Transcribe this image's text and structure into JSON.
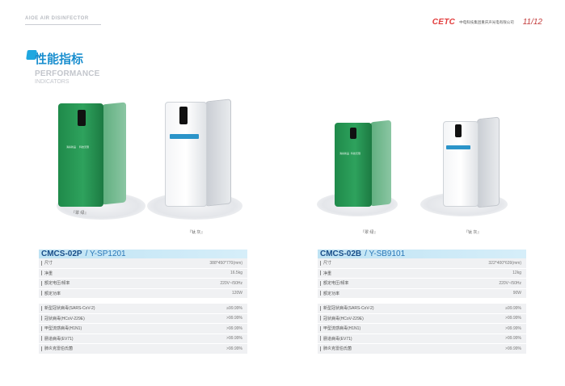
{
  "header": {
    "left_title": "AIOE AIR DISINFECTOR",
    "logo_text": "CETC",
    "company": "中电科技集团重庆声光电有限公司",
    "page": "11/12"
  },
  "title": {
    "cn": "性能指标",
    "en1": "PERFORMANCE",
    "en2": "INDICATORS"
  },
  "product_text": {
    "panel_line1": "消杀新品",
    "panel_line2": "科技无限"
  },
  "products": {
    "left": {
      "green_label": "『翠 绿』",
      "white_label": "『钛 灰』"
    },
    "right": {
      "green_label": "『翠 绿』",
      "white_label": "『钛 灰』"
    }
  },
  "specs": {
    "left": {
      "model": "CMCS-02P",
      "alt": "/ Y-SP1201",
      "rows1": [
        {
          "label": "尺寸",
          "value": "388*450*770(mm)"
        },
        {
          "label": "净重",
          "value": "16.5kg"
        },
        {
          "label": "额定电压/频率",
          "value": "220V~/50Hz"
        },
        {
          "label": "额定功率",
          "value": "120W"
        }
      ],
      "rows2": [
        {
          "label": "新型冠状病毒(SARS-CoV-2)",
          "value": "≥99.99%"
        },
        {
          "label": "冠状病毒(HCoV-229E)",
          "value": ">99.99%"
        },
        {
          "label": "甲型流感病毒(H1N1)",
          "value": ">99.99%"
        },
        {
          "label": "肠道病毒(EV71)",
          "value": ">99.99%"
        },
        {
          "label": "肺炎克雷伯氏菌",
          "value": ">99.99%"
        }
      ]
    },
    "right": {
      "model": "CMCS-02B",
      "alt": "/ Y-SB9101",
      "rows1": [
        {
          "label": "尺寸",
          "value": "322*400*639(mm)"
        },
        {
          "label": "净重",
          "value": "12kg"
        },
        {
          "label": "额定电压/频率",
          "value": "220V~/50Hz"
        },
        {
          "label": "额定功率",
          "value": "90W"
        }
      ],
      "rows2": [
        {
          "label": "新型冠状病毒(SARS-CoV-2)",
          "value": "≥99.99%"
        },
        {
          "label": "冠状病毒(HCoV-229E)",
          "value": ">99.99%"
        },
        {
          "label": "甲型流感病毒(H1N1)",
          "value": ">99.99%"
        },
        {
          "label": "肠道病毒(EV71)",
          "value": ">99.99%"
        },
        {
          "label": "肺炎克雷伯氏菌",
          "value": ">99.99%"
        }
      ]
    }
  }
}
